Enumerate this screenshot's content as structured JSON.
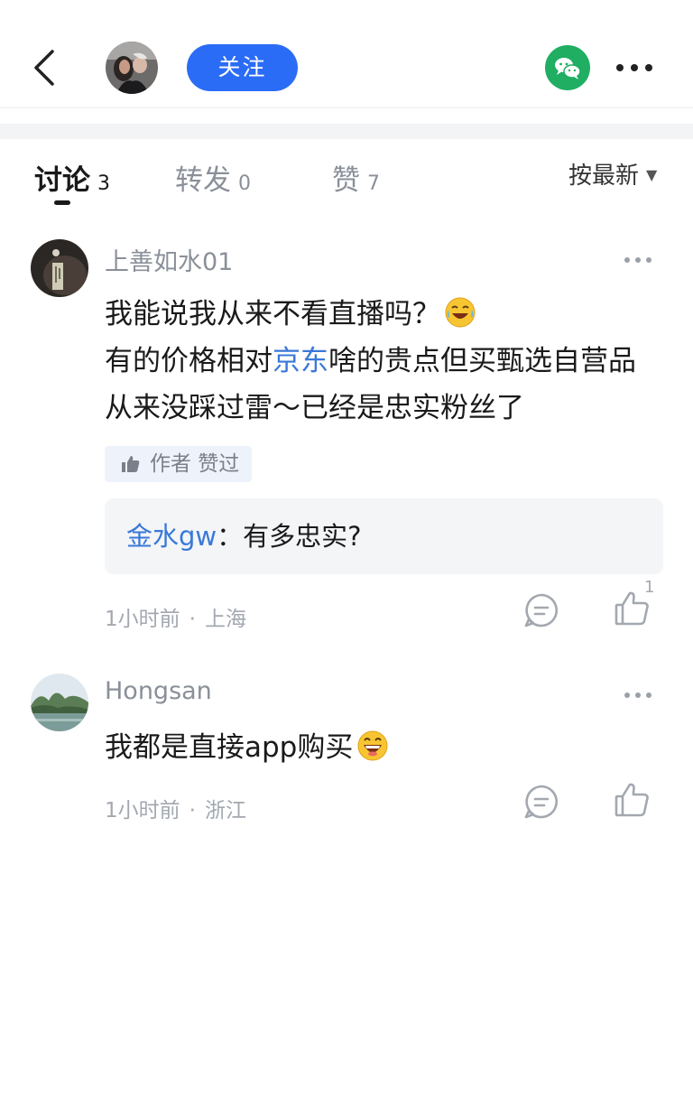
{
  "header": {
    "follow_label": "关注"
  },
  "tabs": [
    {
      "label": "讨论",
      "count": "3",
      "active": true
    },
    {
      "label": "转发",
      "count": "0",
      "active": false
    },
    {
      "label": "赞",
      "count": "7",
      "active": false
    }
  ],
  "sort": {
    "label": "按最新"
  },
  "comments": [
    {
      "user": "上善如水01",
      "text_line1": "我能说我从来不看直播吗？",
      "text_pre_link": "有的价格相对",
      "text_link": "京东",
      "text_post_link": "啥的贵点但买甄选自营品从来没踩过雷～已经是忠实粉丝了",
      "author_liked": "作者 赞过",
      "reply": {
        "user": "金水gw",
        "sep": "：",
        "text": "有多忠实?"
      },
      "time": "1小时前",
      "location": "上海",
      "like_count": "1"
    },
    {
      "user": "Hongsan",
      "text": "我都是直接app购买",
      "time": "1小时前",
      "location": "浙江"
    }
  ],
  "colors": {
    "accent": "#2b6cf6",
    "link": "#3a78d8",
    "wechat": "#1fae62"
  }
}
